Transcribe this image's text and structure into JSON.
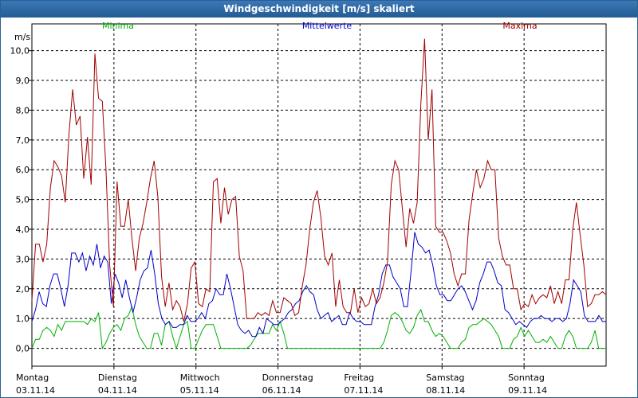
{
  "window": {
    "title": "Windgeschwindigkeit [m/s] skaliert"
  },
  "colors": {
    "minima": "#00b000",
    "mittelwerte": "#0000c8",
    "maxima": "#a00000",
    "grid": "#000000"
  },
  "chart_data": {
    "type": "line",
    "title": "Windgeschwindigkeit [m/s] skaliert",
    "ylabel": "m/s",
    "ylim": [
      -0.6,
      10.9
    ],
    "yticks": [
      "0,0",
      "1,0",
      "2,0",
      "3,0",
      "4,0",
      "5,0",
      "6,0",
      "7,0",
      "8,0",
      "9,0",
      "10,0"
    ],
    "xlim": [
      0,
      7.0
    ],
    "x_categories": [
      {
        "day": "Montag",
        "date": "03.11.14"
      },
      {
        "day": "Dienstag",
        "date": "04.11.14"
      },
      {
        "day": "Mittwoch",
        "date": "05.11.14"
      },
      {
        "day": "Donnerstag",
        "date": "06.11.14"
      },
      {
        "day": "Freitag",
        "date": "07.11.14"
      },
      {
        "day": "Samstag",
        "date": "08.11.14"
      },
      {
        "day": "Sonntag",
        "date": "09.11.14"
      }
    ],
    "grid": true,
    "legend_position": "top",
    "series": [
      {
        "name": "Minima",
        "color": "#00b000",
        "values": [
          0.0,
          0.3,
          0.3,
          0.6,
          0.7,
          0.6,
          0.4,
          0.8,
          0.6,
          0.9,
          0.9,
          0.9,
          0.9,
          0.9,
          0.9,
          0.8,
          1.0,
          0.9,
          1.2,
          0.0,
          0.2,
          0.5,
          0.7,
          0.8,
          0.6,
          1.0,
          1.1,
          1.4,
          0.8,
          0.4,
          0.2,
          0.0,
          0.0,
          0.5,
          0.5,
          0.1,
          0.8,
          0.9,
          0.4,
          0.0,
          0.4,
          0.8,
          0.9,
          0.0,
          0.0,
          0.3,
          0.6,
          0.8,
          0.8,
          0.8,
          0.4,
          0.0,
          0.0,
          0.0,
          0.0,
          0.0,
          0.0,
          0.0,
          0.0,
          0.1,
          0.3,
          0.5,
          0.5,
          0.5,
          0.5,
          0.8,
          0.6,
          0.9,
          0.5,
          0.0,
          0.0,
          0.0,
          0.0,
          0.0,
          0.0,
          0.0,
          0.0,
          0.0,
          0.0,
          0.0,
          0.0,
          0.0,
          0.0,
          0.0,
          0.0,
          0.0,
          0.0,
          0.0,
          0.0,
          0.0,
          0.0,
          0.0,
          0.0,
          0.0,
          0.0,
          0.2,
          0.6,
          1.1,
          1.2,
          1.1,
          0.9,
          0.6,
          0.5,
          0.7,
          1.1,
          1.3,
          0.9,
          0.9,
          0.6,
          0.4,
          0.5,
          0.4,
          0.2,
          0.0,
          0.0,
          0.0,
          0.2,
          0.3,
          0.7,
          0.8,
          0.8,
          0.9,
          1.0,
          0.9,
          0.8,
          0.6,
          0.4,
          0.0,
          0.0,
          0.0,
          0.3,
          0.4,
          0.7,
          0.4,
          0.6,
          0.4,
          0.2,
          0.2,
          0.3,
          0.2,
          0.4,
          0.2,
          0.0,
          0.0,
          0.4,
          0.6,
          0.4,
          0.0,
          0.0,
          0.0,
          0.0,
          0.2,
          0.6,
          0.0,
          0.0,
          0.0
        ]
      },
      {
        "name": "Mittelwerte",
        "color": "#0000c8",
        "values": [
          0.9,
          1.3,
          1.9,
          1.5,
          1.4,
          2.1,
          2.5,
          2.5,
          2.0,
          1.4,
          2.1,
          3.2,
          3.2,
          2.9,
          3.2,
          2.6,
          3.1,
          2.8,
          3.5,
          2.7,
          3.1,
          2.9,
          1.5,
          2.5,
          2.2,
          1.7,
          2.3,
          1.7,
          1.2,
          1.7,
          2.3,
          2.6,
          2.7,
          3.3,
          2.5,
          1.5,
          1.0,
          0.8,
          0.9,
          0.7,
          0.7,
          0.8,
          0.8,
          1.1,
          0.9,
          0.9,
          1.0,
          1.2,
          1.0,
          1.5,
          1.6,
          2.0,
          1.8,
          1.8,
          2.5,
          2.0,
          1.4,
          0.8,
          0.6,
          0.5,
          0.6,
          0.4,
          0.4,
          0.7,
          0.5,
          1.0,
          0.9,
          0.8,
          0.8,
          0.9,
          1.0,
          1.2,
          1.3,
          1.5,
          1.6,
          1.9,
          2.1,
          1.9,
          1.8,
          1.3,
          1.0,
          1.1,
          1.2,
          0.9,
          1.0,
          1.1,
          0.8,
          0.8,
          1.2,
          1.0,
          0.9,
          0.9,
          0.8,
          0.8,
          0.8,
          1.4,
          1.8,
          2.5,
          2.8,
          2.8,
          2.4,
          2.2,
          2.0,
          1.4,
          1.4,
          2.6,
          3.9,
          3.5,
          3.4,
          3.2,
          3.3,
          2.8,
          2.1,
          1.8,
          1.8,
          1.6,
          1.6,
          1.8,
          2.0,
          2.1,
          1.9,
          1.6,
          1.3,
          1.6,
          2.2,
          2.5,
          2.9,
          2.9,
          2.6,
          2.2,
          2.1,
          1.3,
          1.2,
          1.0,
          0.8,
          0.9,
          0.8,
          0.7,
          0.9,
          1.0,
          1.0,
          1.1,
          1.0,
          1.0,
          0.9,
          1.0,
          1.0,
          0.9,
          1.0,
          1.5,
          2.3,
          2.1,
          1.9,
          1.1,
          0.9,
          0.9,
          0.9,
          1.1,
          0.9,
          0.9
        ]
      },
      {
        "name": "Maxima",
        "color": "#a00000",
        "values": [
          1.6,
          3.5,
          3.5,
          2.9,
          3.5,
          5.4,
          6.3,
          6.1,
          5.8,
          4.9,
          7.2,
          8.7,
          7.5,
          7.8,
          5.7,
          7.1,
          5.5,
          9.9,
          8.4,
          8.3,
          6.0,
          2.8,
          1.4,
          5.6,
          4.1,
          4.1,
          5.0,
          3.7,
          2.6,
          3.7,
          4.2,
          4.9,
          5.7,
          6.3,
          5.1,
          2.4,
          1.4,
          2.2,
          1.3,
          1.6,
          1.4,
          0.9,
          1.5,
          2.7,
          2.9,
          1.5,
          1.4,
          2.0,
          1.9,
          5.6,
          5.7,
          4.2,
          5.4,
          4.5,
          5.0,
          5.1,
          3.1,
          2.6,
          1.0,
          1.0,
          1.0,
          1.2,
          1.1,
          1.2,
          1.1,
          1.6,
          1.2,
          1.2,
          1.7,
          1.6,
          1.5,
          1.1,
          1.2,
          2.1,
          2.8,
          4.0,
          4.9,
          5.3,
          4.4,
          3.1,
          2.8,
          3.2,
          1.4,
          2.3,
          1.4,
          1.2,
          1.2,
          2.0,
          1.2,
          1.7,
          1.4,
          1.5,
          2.0,
          1.5,
          1.7,
          2.2,
          2.9,
          5.5,
          6.3,
          6.0,
          4.7,
          3.4,
          4.7,
          4.2,
          4.9,
          8.2,
          10.4,
          7.0,
          8.7,
          4.1,
          3.9,
          3.9,
          3.6,
          3.2,
          2.5,
          2.1,
          2.5,
          2.5,
          4.3,
          5.2,
          6.0,
          5.4,
          5.7,
          6.3,
          6.0,
          6.0,
          3.7,
          3.1,
          2.8,
          2.8,
          2.0,
          2.0,
          1.3,
          1.5,
          1.4,
          1.8,
          1.5,
          1.7,
          1.8,
          1.7,
          2.1,
          1.5,
          1.9,
          1.5,
          2.3,
          2.3,
          4.0,
          4.9,
          3.8,
          2.8,
          1.4,
          1.5,
          1.8,
          1.8,
          1.9,
          1.8
        ]
      }
    ]
  }
}
